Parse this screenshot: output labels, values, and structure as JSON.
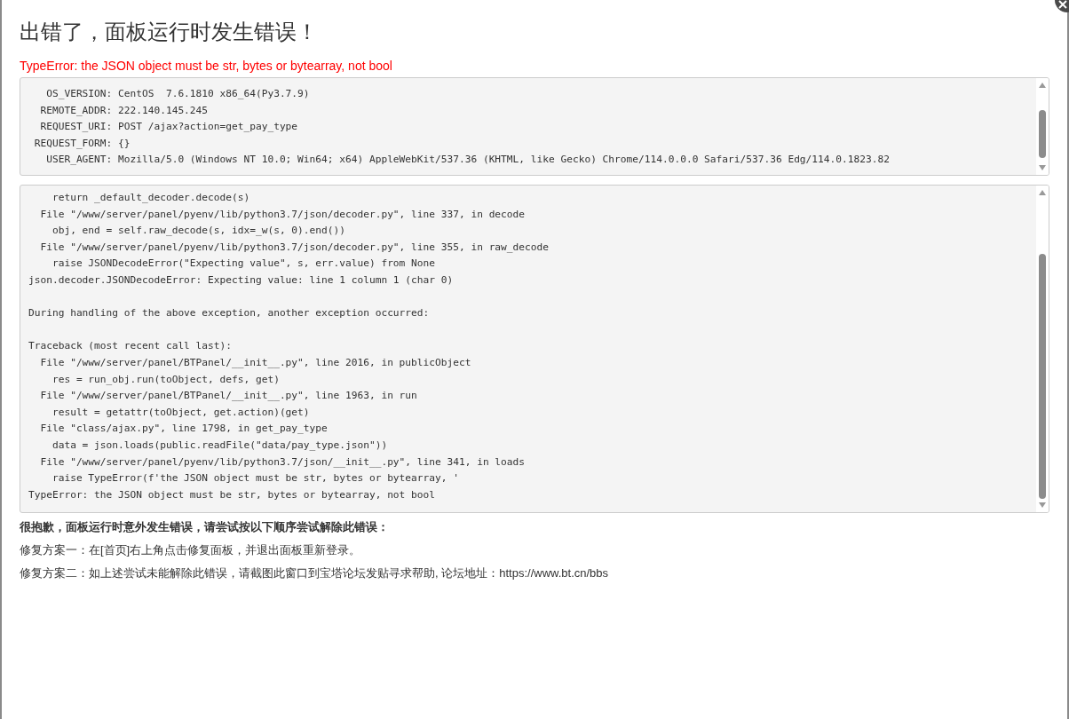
{
  "title": "出错了，面板运行时发生错误！",
  "error_message": "TypeError: the JSON object must be str, bytes or bytearray, not bool",
  "environment_panel": {
    "lines": [
      "   OS_VERSION: CentOS  7.6.1810 x86_64(Py3.7.9)",
      "  REMOTE_ADDR: 222.140.145.245",
      "  REQUEST_URI: POST /ajax?action=get_pay_type",
      " REQUEST_FORM: {}",
      "   USER_AGENT: Mozilla/5.0 (Windows NT 10.0; Win64; x64) AppleWebKit/537.36 (KHTML, like Gecko) Chrome/114.0.0.0 Safari/537.36 Edg/114.0.1823.82"
    ]
  },
  "traceback_panel": {
    "blocks": [
      [
        "    return _default_decoder.decode(s)",
        "  File \"/www/server/panel/pyenv/lib/python3.7/json/decoder.py\", line 337, in decode",
        "    obj, end = self.raw_decode(s, idx=_w(s, 0).end())",
        "  File \"/www/server/panel/pyenv/lib/python3.7/json/decoder.py\", line 355, in raw_decode",
        "    raise JSONDecodeError(\"Expecting value\", s, err.value) from None",
        "json.decoder.JSONDecodeError: Expecting value: line 1 column 1 (char 0)"
      ],
      [
        "During handling of the above exception, another exception occurred:"
      ],
      [
        "Traceback (most recent call last):",
        "  File \"/www/server/panel/BTPanel/__init__.py\", line 2016, in publicObject",
        "    res = run_obj.run(toObject, defs, get)",
        "  File \"/www/server/panel/BTPanel/__init__.py\", line 1963, in run",
        "    result = getattr(toObject, get.action)(get)",
        "  File \"class/ajax.py\", line 1798, in get_pay_type",
        "    data = json.loads(public.readFile(\"data/pay_type.json\"))",
        "  File \"/www/server/panel/pyenv/lib/python3.7/json/__init__.py\", line 341, in loads",
        "    raise TypeError(f'the JSON object must be str, bytes or bytearray, '",
        "TypeError: the JSON object must be str, bytes or bytearray, not bool"
      ]
    ]
  },
  "help": {
    "heading": "很抱歉，面板运行时意外发生错误，请尝试按以下顺序尝试解除此错误：",
    "steps": [
      "修复方案一：在[首页]右上角点击修复面板，并退出面板重新登录。",
      "修复方案二：如上述尝试未能解除此错误，请截图此窗口到宝塔论坛发贴寻求帮助, 论坛地址：https://www.bt.cn/bbs"
    ]
  }
}
